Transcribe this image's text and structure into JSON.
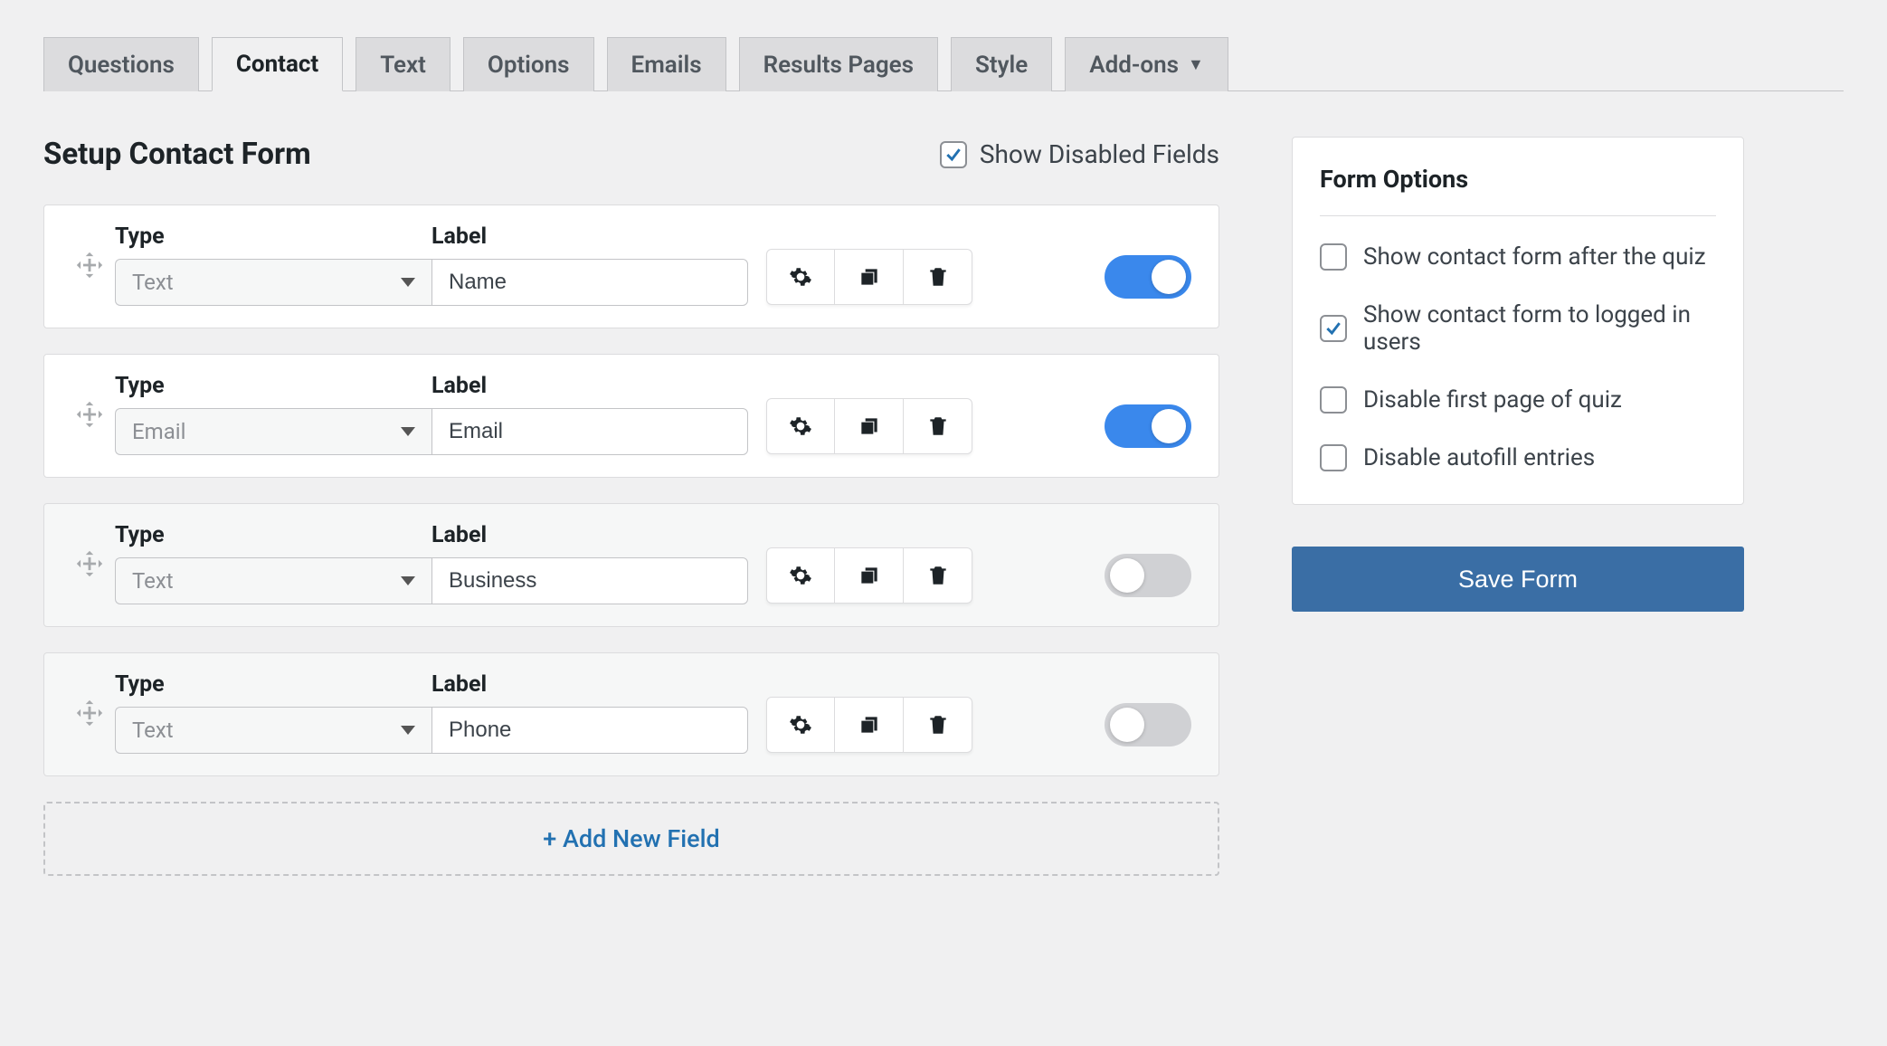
{
  "tabs": [
    {
      "label": "Questions",
      "active": false
    },
    {
      "label": "Contact",
      "active": true
    },
    {
      "label": "Text",
      "active": false
    },
    {
      "label": "Options",
      "active": false
    },
    {
      "label": "Emails",
      "active": false
    },
    {
      "label": "Results Pages",
      "active": false
    },
    {
      "label": "Style",
      "active": false
    },
    {
      "label": "Add-ons",
      "active": false,
      "dropdown": true
    }
  ],
  "page_title": "Setup Contact Form",
  "show_disabled": {
    "label": "Show Disabled Fields",
    "checked": true
  },
  "column_headers": {
    "type": "Type",
    "label": "Label"
  },
  "fields": [
    {
      "type": "Text",
      "label": "Name",
      "enabled": true
    },
    {
      "type": "Email",
      "label": "Email",
      "enabled": true
    },
    {
      "type": "Text",
      "label": "Business",
      "enabled": false
    },
    {
      "type": "Text",
      "label": "Phone",
      "enabled": false
    }
  ],
  "add_new_label": "+ Add New Field",
  "form_options": {
    "title": "Form Options",
    "items": [
      {
        "label": "Show contact form after the quiz",
        "checked": false
      },
      {
        "label": "Show contact form to logged in users",
        "checked": true
      },
      {
        "label": "Disable first page of quiz",
        "checked": false
      },
      {
        "label": "Disable autofill entries",
        "checked": false
      }
    ]
  },
  "save_button": "Save Form"
}
